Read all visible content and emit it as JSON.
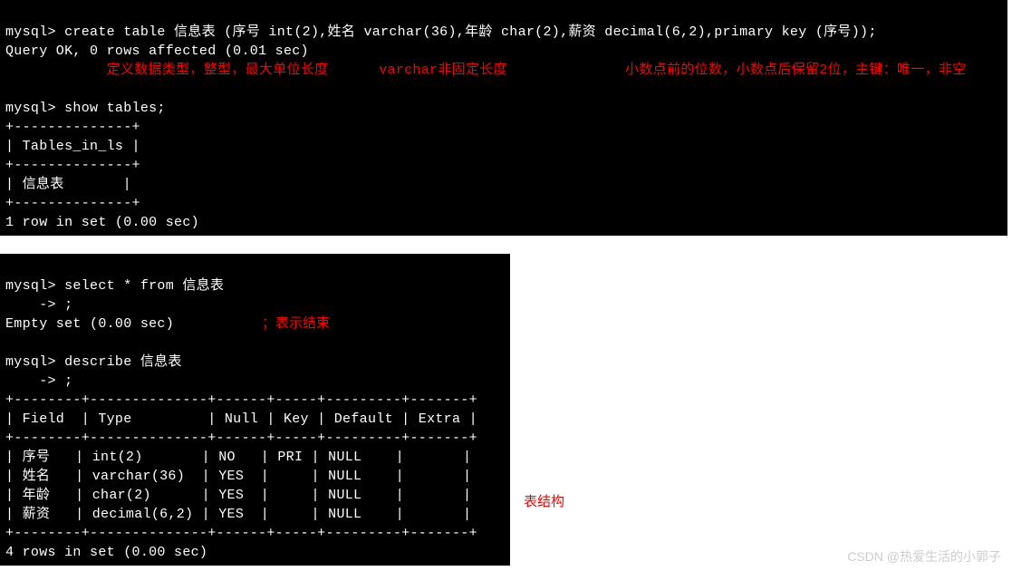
{
  "term1": {
    "line1": "mysql> create table 信息表 (序号 int(2),姓名 varchar(36),年龄 char(2),薪资 decimal(6,2),primary key (序号));",
    "line2": "Query OK, 0 rows affected (0.01 sec)",
    "anno1": "            定义数据类型，整型，最大单位长度      varchar非固定长度              小数点前的位数，小数点后保留2位，主键：唯一，非空",
    "line3": "mysql> show tables;",
    "border": "+--------------+",
    "header": "| Tables_in_ls |",
    "row1": "| 信息表       |",
    "footer": "1 row in set (0.00 sec)"
  },
  "term2": {
    "line1": "mysql> select * from 信息表",
    "line2": "    -> ;",
    "line3": "Empty set (0.00 sec)",
    "blank1": "",
    "line4": "mysql> describe 信息表",
    "line5": "    -> ;",
    "tborder": "+--------+--------------+------+-----+---------+-------+",
    "theader": "| Field  | Type         | Null | Key | Default | Extra |",
    "trow1": "| 序号   | int(2)       | NO   | PRI | NULL    |       |",
    "trow2": "| 姓名   | varchar(36)  | YES  |     | NULL    |       |",
    "trow3": "| 年龄   | char(2)      | YES  |     | NULL    |       |",
    "trow4": "| 薪资   | decimal(6,2) | YES  |     | NULL    |       |",
    "tfooter": "4 rows in set (0.00 sec)"
  },
  "annotations": {
    "semicolon": "；表示结束",
    "structure": "表结构"
  },
  "watermark": "CSDN @热爱生活的小郭子"
}
